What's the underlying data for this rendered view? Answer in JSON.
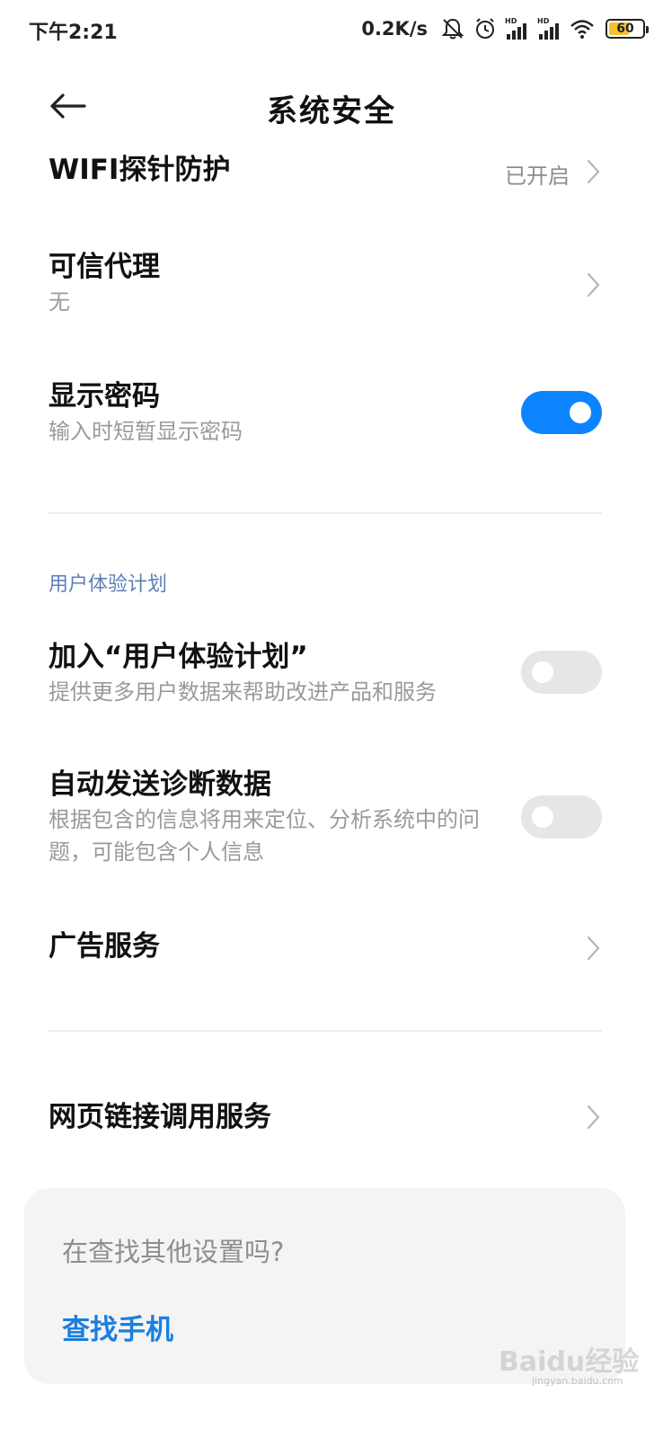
{
  "status_bar": {
    "time": "下午2:21",
    "net_speed": "0.2K/s",
    "battery_level": "60",
    "icons": [
      "mute-bell-icon",
      "alarm-icon",
      "hd-signal-icon",
      "hd-signal-icon",
      "wifi-icon",
      "battery-icon"
    ],
    "battery_fill_percent": 60
  },
  "header": {
    "title": "系统安全",
    "back_icon": "arrow-left-icon"
  },
  "settings": {
    "wifi_probe": {
      "title": "WIFI探针防护",
      "value": "已开启"
    },
    "trusted_agent": {
      "title": "可信代理",
      "subtitle": "无"
    },
    "show_password": {
      "title": "显示密码",
      "subtitle": "输入时短暂显示密码",
      "enabled": true
    },
    "section_user_experience": "用户体验计划",
    "join_ux": {
      "title": "加入“用户体验计划”",
      "subtitle": "提供更多用户数据来帮助改进产品和服务",
      "enabled": false
    },
    "auto_diagnostics": {
      "title": "自动发送诊断数据",
      "subtitle": "根据包含的信息将用来定位、分析系统中的问题，可能包含个人信息",
      "enabled": false
    },
    "ad_service": {
      "title": "广告服务"
    },
    "web_link_service": {
      "title": "网页链接调用服务"
    }
  },
  "suggestion": {
    "question": "在查找其他设置吗?",
    "link": "查找手机"
  },
  "watermark": {
    "brand": "Baidu经验",
    "url": "jingyan.baidu.com"
  },
  "colors": {
    "accent": "#0d84ff",
    "link": "#1a7fe0",
    "section_header": "#5e7fb8",
    "toggle_off": "#e6e6e6"
  }
}
